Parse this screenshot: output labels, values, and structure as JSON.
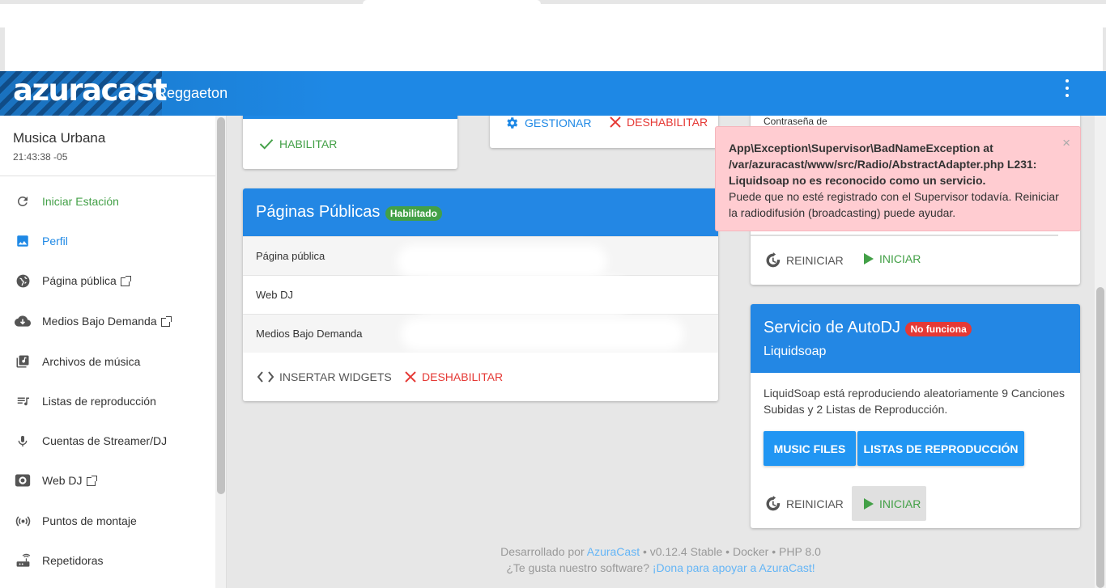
{
  "header": {
    "logo": "azuracast",
    "station": "Reggaeton"
  },
  "sidebar": {
    "station_title": "Musica Urbana",
    "station_time": "21:43:38 -05",
    "items": [
      {
        "label": "Iniciar Estación",
        "icon": "restart-icon",
        "external": false
      },
      {
        "label": "Perfil",
        "icon": "image-icon",
        "external": false
      },
      {
        "label": "Página pública",
        "icon": "globe-icon",
        "external": true
      },
      {
        "label": "Medios Bajo Demanda",
        "icon": "cloud-download-icon",
        "external": true
      },
      {
        "label": "Archivos de música",
        "icon": "library-music-icon",
        "external": false
      },
      {
        "label": "Listas de reproducción",
        "icon": "queue-music-icon",
        "external": false
      },
      {
        "label": "Cuentas de Streamer/DJ",
        "icon": "mic-icon",
        "external": false
      },
      {
        "label": "Web DJ",
        "icon": "speaker-icon",
        "external": true
      },
      {
        "label": "Puntos de montaje",
        "icon": "broadcast-icon",
        "external": false
      },
      {
        "label": "Repetidoras",
        "icon": "router-icon",
        "external": false
      }
    ]
  },
  "cards": {
    "top_left": {
      "enable_label": "HABILITAR"
    },
    "top_middle": {
      "manage_label": "GESTIONAR",
      "disable_label": "DESHABILITAR"
    },
    "top_right": {
      "partial_text": "Contraseña de",
      "restart_label": "REINICIAR",
      "start_label": "INICIAR"
    },
    "public_pages": {
      "title": "Páginas Públicas",
      "badge": "Habilitado",
      "rows": [
        "Página pública",
        "Web DJ",
        "Medios Bajo Demanda"
      ],
      "embed_label": "INSERTAR WIDGETS",
      "disable_label": "DESHABILITAR"
    },
    "autodj": {
      "title": "Servicio de AutoDJ",
      "badge": "No funciona",
      "subtitle": "Liquidsoap",
      "description": "LiquidSoap está reproduciendo aleatoriamente 9 Canciones Subidas y 2 Listas de Reproducción.",
      "music_files_label": "MUSIC FILES",
      "playlists_label": "LISTAS DE REPRODUCCIÓN",
      "restart_label": "REINICIAR",
      "start_label": "INICIAR"
    }
  },
  "alert": {
    "line1": "App\\Exception\\Supervisor\\BadNameException at",
    "line2": "/var/azuracast/www/src/Radio/AbstractAdapter.php L231:",
    "line3": "Liquidsoap no es reconocido como un servicio.",
    "line4": "Puede que no esté registrado con el Supervisor todavía. Reiniciar la radiodifusión (broadcasting) puede ayudar.",
    "close": "×"
  },
  "footer": {
    "dev_prefix": "Desarrollado por",
    "dev_link": "AzuraCast",
    "version": "• v0.12.4 Stable • Docker • PHP 8.0",
    "like_prefix": "¿Te gusta nuestro software?",
    "donate_link": "¡Dona para apoyar a AzuraCast!"
  },
  "colors": {
    "primary": "#1e88e5",
    "success": "#43a047",
    "danger": "#e53935",
    "alert_bg": "#ffccd1"
  }
}
